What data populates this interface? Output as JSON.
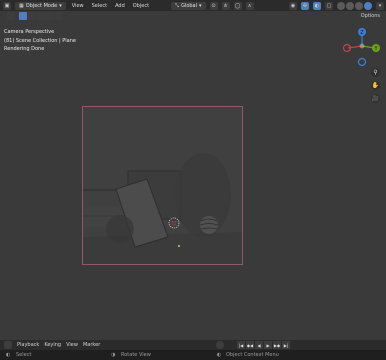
{
  "header": {
    "mode": "Object Mode",
    "menus": [
      "View",
      "Select",
      "Add",
      "Object"
    ],
    "orientation": "Global"
  },
  "toolbar": {
    "options_label": "Options"
  },
  "overlay": {
    "view": "Camera Perspective",
    "collection": "(81) Scene Collection | Plane",
    "status": "Rendering Done"
  },
  "gizmo": {
    "z": "Z",
    "y": "Y",
    "x": "X"
  },
  "timeline": {
    "menus": [
      "Playback",
      "Keying",
      "View",
      "Marker"
    ]
  },
  "statusbar": {
    "select": "Select",
    "rotate": "Rotate View",
    "context": "Object Context Menu"
  },
  "colors": {
    "x_axis": "#c8404e",
    "y_axis": "#6ba31a",
    "z_axis": "#3d7fd6",
    "active": "#4f7fc0",
    "camera_frame": "#8c5b68"
  },
  "icons": [
    "editor-type-icon",
    "object-mode-icon",
    "transform-icon",
    "snap-icon",
    "proportional-icon",
    "visibility-icon",
    "gizmo-icon",
    "overlay-icon",
    "xray-icon",
    "shading-wire-icon",
    "shading-solid-icon",
    "shading-material-icon",
    "shading-render-icon",
    "zoom-icon",
    "hand-icon",
    "camera-icon",
    "rewind-icon",
    "prev-key-icon",
    "play-reverse-icon",
    "play-icon",
    "next-key-icon",
    "end-icon"
  ]
}
